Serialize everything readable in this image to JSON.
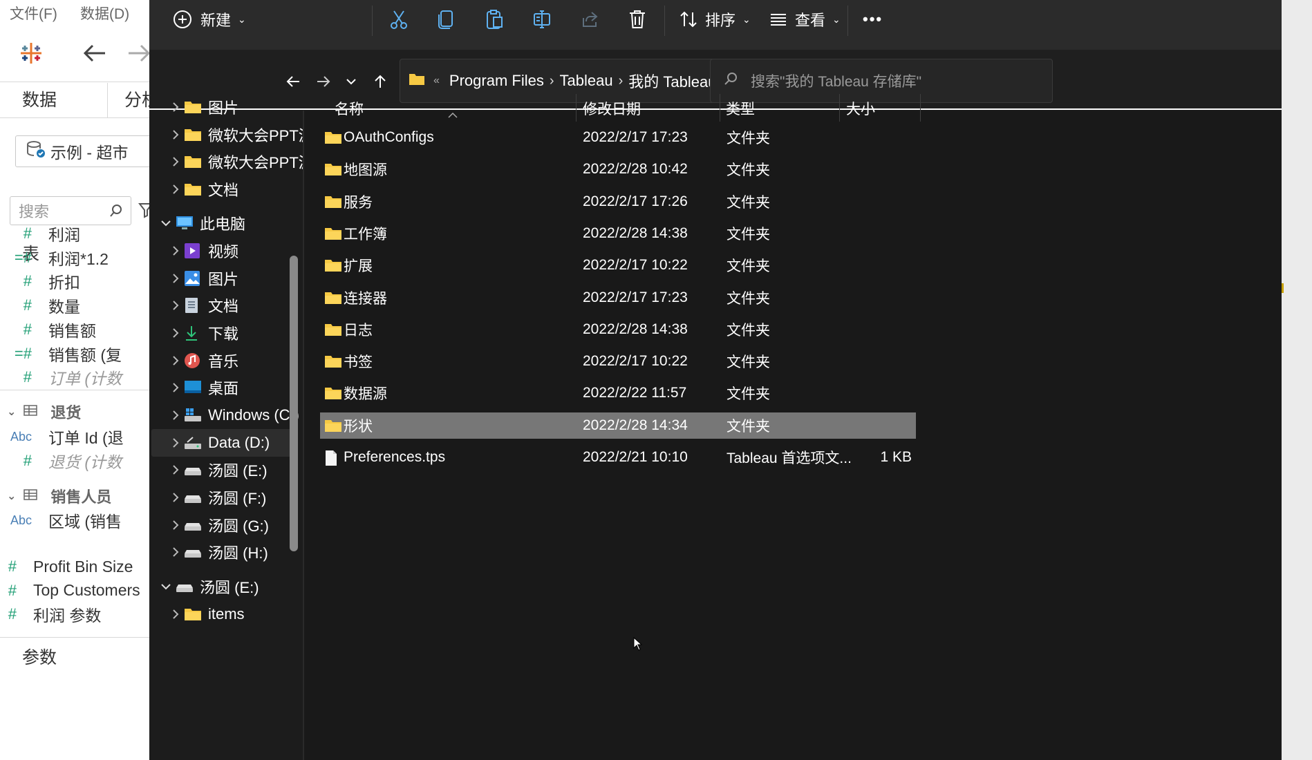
{
  "tableau": {
    "menu": [
      "文件(F)",
      "数据(D)"
    ],
    "tabs": {
      "data": "数据",
      "analysis": "分析"
    },
    "datasource": "示例 - 超市",
    "search_placeholder": "搜索",
    "tables_header": "表",
    "fields": [
      {
        "icon": "#",
        "label": "利润",
        "italic": false
      },
      {
        "icon": "=#",
        "label": "利润*1.2",
        "italic": false
      },
      {
        "icon": "#",
        "label": "折扣",
        "italic": false
      },
      {
        "icon": "#",
        "label": "数量",
        "italic": false
      },
      {
        "icon": "#",
        "label": "销售额",
        "italic": false
      },
      {
        "icon": "=#",
        "label": "销售额 (复",
        "italic": false
      },
      {
        "icon": "#",
        "label": "订单 (计数",
        "italic": true
      }
    ],
    "group_returns": "退货",
    "returns_fields": [
      {
        "icon": "Abc",
        "label": "订单 Id (退",
        "italic": false
      },
      {
        "icon": "#",
        "label": "退货 (计数",
        "italic": true
      }
    ],
    "group_sales": "销售人员",
    "sales_fields": [
      {
        "icon": "Abc",
        "label": "区域 (销售",
        "italic": false
      }
    ],
    "params_header": "参数",
    "params": [
      "Profit Bin Size",
      "Top Customers",
      "利润 参数"
    ]
  },
  "explorer": {
    "commands": {
      "new": "新建",
      "sort": "排序",
      "view": "查看",
      "more": "•••"
    },
    "address": {
      "crumbs": [
        "Program Files",
        "Tableau",
        "我的 Tableau 存储库"
      ]
    },
    "search_placeholder": "搜索\"我的 Tableau 存储库\"",
    "columns": {
      "name": "名称",
      "date": "修改日期",
      "type": "类型",
      "size": "大小"
    },
    "nav_items": [
      {
        "label": "图片",
        "icon": "folder",
        "indent": 1
      },
      {
        "label": "微软大会PPT源文件",
        "icon": "folder",
        "indent": 1
      },
      {
        "label": "微软大会PPT源文件",
        "icon": "folder",
        "indent": 1
      },
      {
        "label": "文档",
        "icon": "folder",
        "indent": 1
      },
      {
        "label": "此电脑",
        "icon": "pc",
        "indent": 0,
        "expanded": true
      },
      {
        "label": "视频",
        "icon": "video",
        "indent": 1
      },
      {
        "label": "图片",
        "icon": "pictures",
        "indent": 1
      },
      {
        "label": "文档",
        "icon": "documents",
        "indent": 1
      },
      {
        "label": "下载",
        "icon": "download",
        "indent": 1
      },
      {
        "label": "音乐",
        "icon": "music",
        "indent": 1
      },
      {
        "label": "桌面",
        "icon": "desktop",
        "indent": 1
      },
      {
        "label": "Windows (C:)",
        "icon": "windows-drive",
        "indent": 1
      },
      {
        "label": "Data (D:)",
        "icon": "drive",
        "indent": 1,
        "selected": true
      },
      {
        "label": "汤圆 (E:)",
        "icon": "removable",
        "indent": 1
      },
      {
        "label": "汤圆 (F:)",
        "icon": "removable",
        "indent": 1
      },
      {
        "label": "汤圆 (G:)",
        "icon": "removable",
        "indent": 1
      },
      {
        "label": "汤圆 (H:)",
        "icon": "removable",
        "indent": 1
      },
      {
        "label": "汤圆 (E:)",
        "icon": "removable",
        "indent": 0,
        "expanded": true
      },
      {
        "label": "items",
        "icon": "folder",
        "indent": 1
      }
    ],
    "files": [
      {
        "name": "OAuthConfigs",
        "date": "2022/2/17 17:23",
        "type": "文件夹",
        "size": "",
        "icon": "folder"
      },
      {
        "name": "地图源",
        "date": "2022/2/28 10:42",
        "type": "文件夹",
        "size": "",
        "icon": "folder"
      },
      {
        "name": "服务",
        "date": "2022/2/17 17:26",
        "type": "文件夹",
        "size": "",
        "icon": "folder"
      },
      {
        "name": "工作簿",
        "date": "2022/2/28 14:38",
        "type": "文件夹",
        "size": "",
        "icon": "folder"
      },
      {
        "name": "扩展",
        "date": "2022/2/17 10:22",
        "type": "文件夹",
        "size": "",
        "icon": "folder"
      },
      {
        "name": "连接器",
        "date": "2022/2/17 17:23",
        "type": "文件夹",
        "size": "",
        "icon": "folder"
      },
      {
        "name": "日志",
        "date": "2022/2/28 14:38",
        "type": "文件夹",
        "size": "",
        "icon": "folder"
      },
      {
        "name": "书签",
        "date": "2022/2/17 10:22",
        "type": "文件夹",
        "size": "",
        "icon": "folder"
      },
      {
        "name": "数据源",
        "date": "2022/2/22 11:57",
        "type": "文件夹",
        "size": "",
        "icon": "folder"
      },
      {
        "name": "形状",
        "date": "2022/2/28 14:34",
        "type": "文件夹",
        "size": "",
        "icon": "folder",
        "selected": true
      },
      {
        "name": "Preferences.tps",
        "date": "2022/2/21 10:10",
        "type": "Tableau 首选项文...",
        "size": "1 KB",
        "icon": "file"
      }
    ],
    "colors": {
      "folder": "#f6c944",
      "selected_row": "#777777",
      "bg": "#191919"
    }
  }
}
